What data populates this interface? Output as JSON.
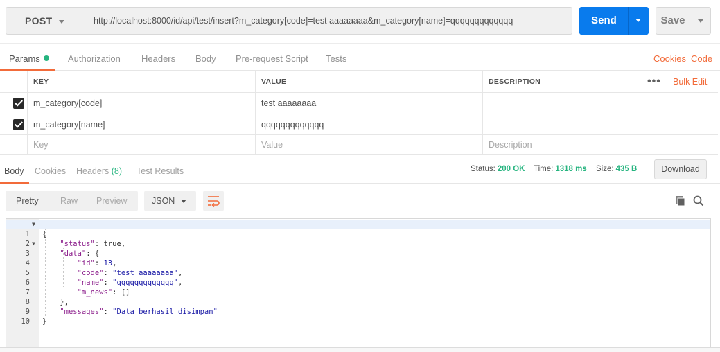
{
  "request": {
    "method": "POST",
    "url": "http://localhost:8000/id/api/test/insert?m_category[code]=test aaaaaaaa&m_category[name]=qqqqqqqqqqqqq",
    "send_label": "Send",
    "save_label": "Save"
  },
  "request_tabs": {
    "params": "Params",
    "authorization": "Authorization",
    "headers": "Headers",
    "body": "Body",
    "prerequest": "Pre-request Script",
    "tests": "Tests",
    "cookies": "Cookies",
    "code": "Code"
  },
  "params_table": {
    "headers": {
      "key": "KEY",
      "value": "VALUE",
      "description": "DESCRIPTION",
      "bulk_edit": "Bulk Edit"
    },
    "rows": [
      {
        "key": "m_category[code]",
        "value": "test aaaaaaaa",
        "description": "",
        "checked": true
      },
      {
        "key": "m_category[name]",
        "value": "qqqqqqqqqqqqq",
        "description": "",
        "checked": true
      }
    ],
    "placeholders": {
      "key": "Key",
      "value": "Value",
      "description": "Description"
    }
  },
  "response_tabs": {
    "body": "Body",
    "cookies": "Cookies",
    "headers": "Headers",
    "headers_count": "(8)",
    "test_results": "Test Results"
  },
  "response_status": {
    "status_label": "Status:",
    "status_value": "200 OK",
    "time_label": "Time:",
    "time_value": "1318 ms",
    "size_label": "Size:",
    "size_value": "435 B",
    "download_label": "Download"
  },
  "response_view": {
    "pretty": "Pretty",
    "raw": "Raw",
    "preview": "Preview",
    "format": "JSON"
  },
  "response_body": {
    "line_numbers": [
      "1",
      "2",
      "3",
      "4",
      "5",
      "6",
      "7",
      "8",
      "9",
      "10"
    ],
    "status_key": "\"status\"",
    "status_val": "true",
    "data_key": "\"data\"",
    "id_key": "\"id\"",
    "id_val": "13",
    "code_key": "\"code\"",
    "code_val": "\"test aaaaaaaa\"",
    "name_key": "\"name\"",
    "name_val": "\"qqqqqqqqqqqqq\"",
    "news_key": "\"m_news\"",
    "news_val": "[]",
    "messages_key": "\"messages\"",
    "messages_val": "\"Data berhasil disimpan\""
  },
  "colors": {
    "accent": "#f26b3a",
    "send_blue": "#097bed",
    "success_green": "#26b47f"
  }
}
